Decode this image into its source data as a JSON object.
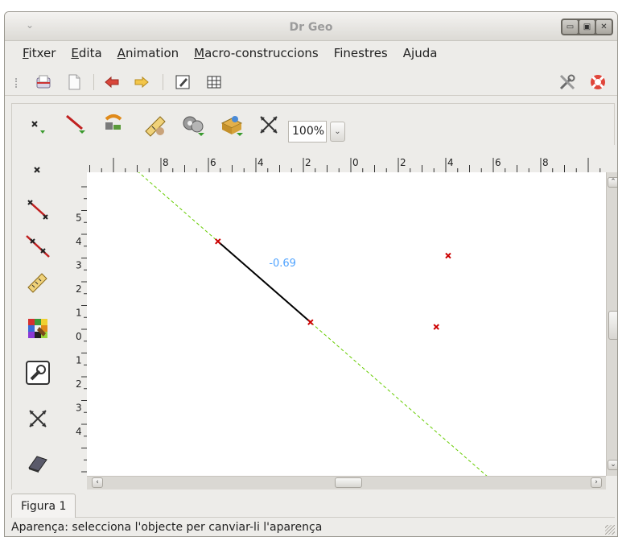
{
  "window": {
    "title": "Dr Geo",
    "menu_glyph": "⌄"
  },
  "window_controls": [
    {
      "name": "minimize-button",
      "glyph": "▭"
    },
    {
      "name": "maximize-button",
      "glyph": "▣"
    },
    {
      "name": "close-button",
      "glyph": "✕"
    }
  ],
  "menubar": [
    {
      "label": "Fitxer",
      "mnemonic": "F"
    },
    {
      "label": "Edita",
      "mnemonic": "E"
    },
    {
      "label": "Animation",
      "mnemonic": "A"
    },
    {
      "label": "Macro-construccions",
      "mnemonic": "M"
    },
    {
      "label": "Finestres",
      "mnemonic": ""
    },
    {
      "label": "Ajuda",
      "mnemonic": "j"
    }
  ],
  "toolbar": {
    "items": [
      "open-file-icon",
      "new-file-icon",
      "back-arrow-icon",
      "forward-arrow-icon",
      "edit-icon",
      "grid-icon"
    ],
    "right_items": [
      "tools-icon",
      "help-lifebuoy-icon"
    ]
  },
  "construction_toolbar": {
    "items": [
      "point-tool-icon",
      "line-tool-icon",
      "transformation-tool-icon",
      "measure-tool-icon",
      "macro-tool-icon",
      "script-tool-icon",
      "move-tool-icon"
    ],
    "zoom": {
      "value": "100%",
      "options": [
        "100%"
      ]
    }
  },
  "side_toolbar": {
    "items": [
      "free-point-icon",
      "segment-icon",
      "line-through-points-icon",
      "distance-measure-icon",
      "style-palette-icon",
      "properties-wrench-icon",
      "move-arrows-icon",
      "eraser-icon"
    ]
  },
  "rulers": {
    "horizontal": [
      "-8",
      "-6",
      "-4",
      "-2",
      "0",
      "2",
      "4",
      "6",
      "8"
    ],
    "vertical": [
      "5",
      "4",
      "3",
      "2",
      "1",
      "0",
      "-1",
      "-2",
      "-3",
      "-4"
    ]
  },
  "figure": {
    "segment_value": "-0.69",
    "points": [
      {
        "name": "point-a",
        "x": -5.6,
        "y": 3.7
      },
      {
        "name": "point-b",
        "x": -1.7,
        "y": 0.3
      },
      {
        "name": "point-c",
        "x": 4.1,
        "y": 3.1
      },
      {
        "name": "point-d",
        "x": 3.6,
        "y": 0.1
      }
    ]
  },
  "colors": {
    "line": "#66cc00",
    "segment": "#000000",
    "point": "#cc0000",
    "value_label": "#4fa3ff"
  },
  "tabs": [
    {
      "label": "Figura 1",
      "active": true
    }
  ],
  "status": {
    "text": "Aparença: selecciona l'objecte per canviar-li l'aparença"
  }
}
